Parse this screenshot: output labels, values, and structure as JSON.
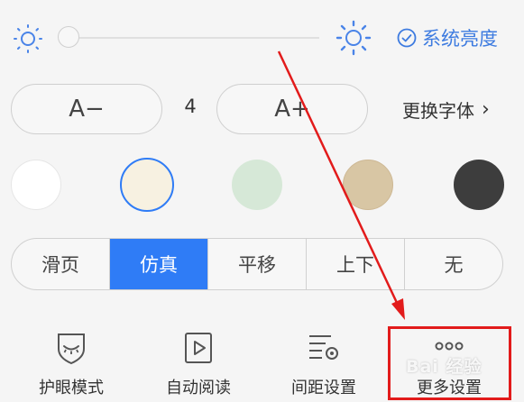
{
  "brightness": {
    "level": 0.0,
    "system_label": "系统亮度"
  },
  "font_size": {
    "decrease_label": "A−",
    "value": "4",
    "increase_label": "A+",
    "change_font_label": "更换字体",
    "chevron": "›"
  },
  "themes": [
    {
      "name": "white",
      "color": "#ffffff",
      "selected": false
    },
    {
      "name": "cream",
      "color": "#f7f1e1",
      "selected": true
    },
    {
      "name": "green",
      "color": "#d6e8d7",
      "selected": false
    },
    {
      "name": "tan",
      "color": "#d8c6a4",
      "selected": false
    },
    {
      "name": "dark",
      "color": "#3d3d3d",
      "selected": false
    }
  ],
  "page_turn": {
    "options": [
      "滑页",
      "仿真",
      "平移",
      "上下",
      "无"
    ],
    "selected": "仿真"
  },
  "tools": [
    {
      "label": "护眼模式",
      "icon": "eye-protection-icon"
    },
    {
      "label": "自动阅读",
      "icon": "auto-read-icon"
    },
    {
      "label": "间距设置",
      "icon": "spacing-settings-icon"
    },
    {
      "label": "更多设置",
      "icon": "more-settings-icon"
    }
  ],
  "watermark": "Bai 经验",
  "colors": {
    "accent": "#2f7cf6",
    "sun": "#4a84e8",
    "annotation": "#e21b1b"
  }
}
